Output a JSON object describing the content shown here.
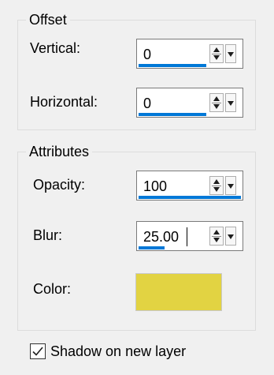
{
  "offset": {
    "title": "Offset",
    "vertical": {
      "label": "Vertical:",
      "value": "0",
      "fill": 0.66
    },
    "horizontal": {
      "label": "Horizontal:",
      "value": "0",
      "fill": 0.66
    }
  },
  "attributes": {
    "title": "Attributes",
    "opacity": {
      "label": "Opacity:",
      "value": "100",
      "fill": 1.0
    },
    "blur": {
      "label": "Blur:",
      "value": "25.00",
      "fill": 0.25
    },
    "color": {
      "label": "Color:",
      "value": "#e2d342"
    }
  },
  "shadow_layer": {
    "label": "Shadow on new layer",
    "checked": true
  },
  "accent_color": "#0078d7"
}
